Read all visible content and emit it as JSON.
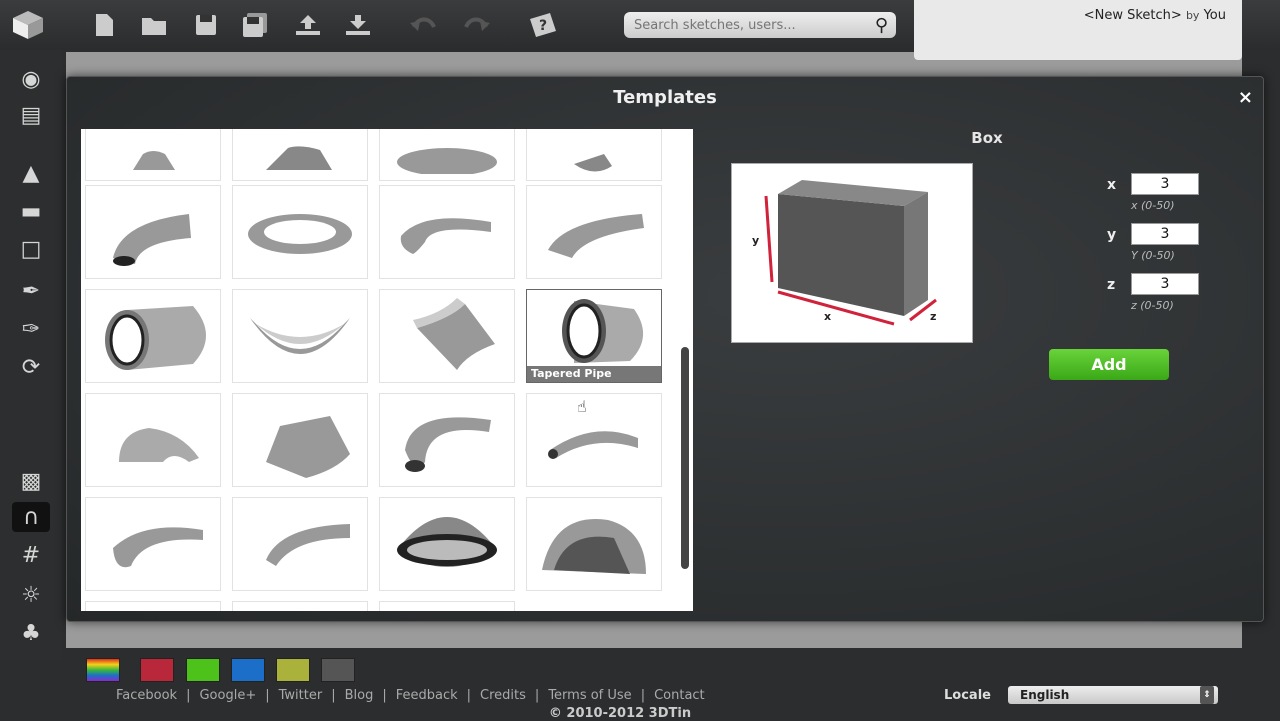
{
  "toolbar": {
    "search_placeholder": "Search sketches, users...",
    "sketch_name": "<New Sketch>",
    "by_label": "by",
    "author": "You"
  },
  "dialog": {
    "title": "Templates",
    "close": "×",
    "hovered_template_caption": "Tapered Pipe",
    "selected_shape_title": "Box",
    "preview_axis_labels": {
      "y": "y",
      "x": "x",
      "z": "z"
    },
    "dimensions": [
      {
        "axis": "x",
        "value": "3",
        "range": "x (0-50)"
      },
      {
        "axis": "y",
        "value": "3",
        "range": "Y (0-50)"
      },
      {
        "axis": "z",
        "value": "3",
        "range": "z (0-50)"
      }
    ],
    "add_label": "Add"
  },
  "footer": {
    "swatches": [
      "#e0301e",
      "#b8283a",
      "#4cc21a",
      "#1b6fc9",
      "#aab23b",
      "#555555"
    ],
    "links": [
      "Facebook",
      "Google+",
      "Twitter",
      "Blog",
      "Feedback",
      "Credits",
      "Terms of Use",
      "Contact"
    ],
    "locale_label": "Locale",
    "locale_value": "English",
    "copyright": "© 2010-2012 3DTin"
  }
}
